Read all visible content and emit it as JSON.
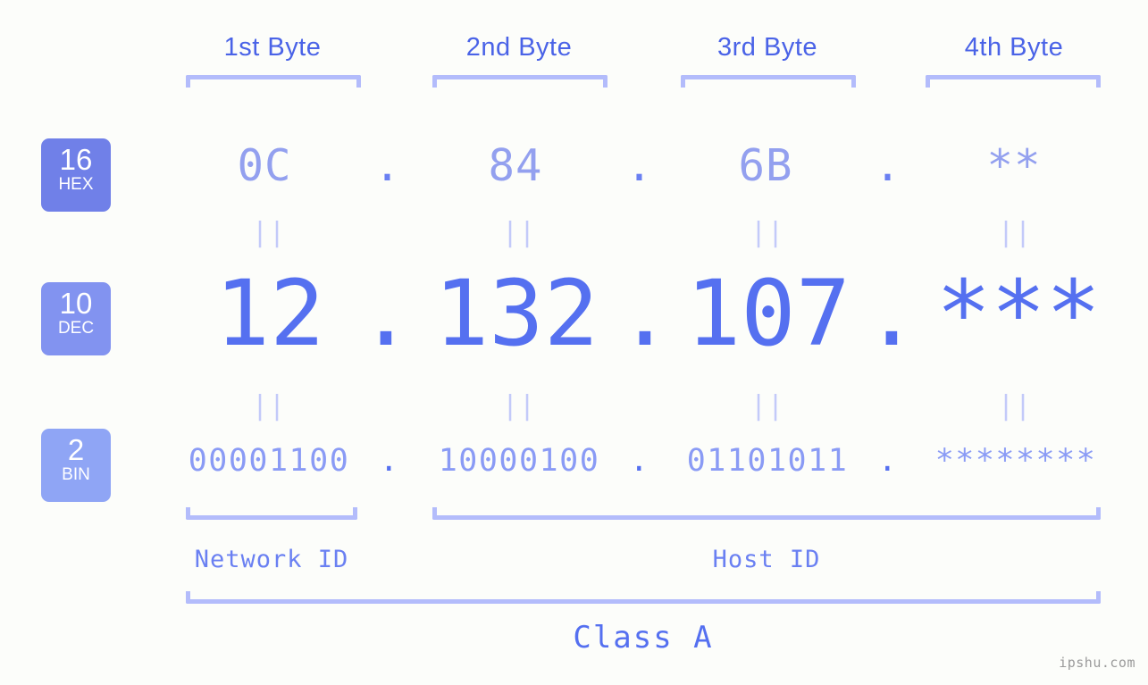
{
  "background_color": "#fcfdfa",
  "accent_color": "#5570f0",
  "bracket_color": "#b3bcfb",
  "byte_headers": [
    {
      "label": "1st Byte"
    },
    {
      "label": "2nd Byte"
    },
    {
      "label": "3rd Byte"
    },
    {
      "label": "4th Byte"
    }
  ],
  "radix_badges": [
    {
      "number": "16",
      "name": "HEX",
      "color": "#7080e8"
    },
    {
      "number": "10",
      "name": "DEC",
      "color": "#8293f0"
    },
    {
      "number": "2",
      "name": "BIN",
      "color": "#8fa5f5"
    }
  ],
  "rows": {
    "hex": {
      "octets": [
        "0C",
        "84",
        "6B",
        "**"
      ],
      "separator": "."
    },
    "dec": {
      "octets": [
        "12",
        "132",
        "107",
        "***"
      ],
      "separator": "."
    },
    "bin": {
      "octets": [
        "00001100",
        "10000100",
        "01101011",
        "********"
      ],
      "separator": "."
    }
  },
  "equals_marks": [
    "||",
    "||",
    "||",
    "||",
    "||",
    "||",
    "||",
    "||"
  ],
  "id_labels": {
    "network": "Network ID",
    "host": "Host ID"
  },
  "class_label": "Class A",
  "watermark": "ipshu.com"
}
